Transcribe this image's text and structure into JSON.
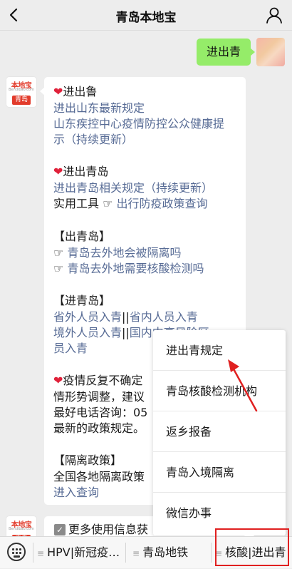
{
  "navbar": {
    "title": "青岛本地宝"
  },
  "user_message": "进出青",
  "bot_avatar": {
    "logo": "本地宝",
    "logo_sub": "Bendibao.com",
    "city": "青岛"
  },
  "message": {
    "heart_glyph": "❤",
    "pointer_glyph": "☞",
    "sec1_title": "进出鲁",
    "sec1_link1": "进出山东最新规定",
    "sec1_link2_l1": "山东疾控中心疫情防控公众健康提",
    "sec1_link2_l2": "示（持续更新）",
    "sec2_title": "进出青岛",
    "sec2_link1": "进出青岛相关规定（持续更新）",
    "sec2_tool_label": "实用工具",
    "sec2_tool_link": "出行防疫政策查询",
    "sec3_title": "【出青岛】",
    "sec3_link1": "青岛去外地会被隔离吗",
    "sec3_link2": "青岛去外地需要核酸检测吗",
    "sec4_title": "【进青岛】",
    "sec4_a": "省外人员入青",
    "sec4_sep": "||",
    "sec4_b": "省内人员入青",
    "sec4_c": "境外人员入青",
    "sec4_d": "国内中高风险区",
    "sec4_e": "员入青",
    "sec5_l1": "疫情反复不确定",
    "sec5_l2": "情形势调整，建议",
    "sec5_l3": "最好电话咨询：05",
    "sec5_l4": "最新的政策规定。",
    "sec6_title": "【隔离政策】",
    "sec6_l1": "全国各地隔离政策",
    "sec6_link": "进入查询"
  },
  "message2": {
    "check_glyph": "✓",
    "text": "更多使用信息获"
  },
  "popup_menu": {
    "items": [
      "进出青规定",
      "青岛核酸检测机构",
      "返乡报备",
      "青岛入境隔离",
      "微信办事"
    ]
  },
  "bottom_menu": {
    "hamburger_glyph": "≡",
    "items": [
      "HPV|新冠疫…",
      "青岛地铁",
      "核酸|进出青"
    ]
  },
  "colors": {
    "link": "#576b95",
    "user_bubble": "#95ec69",
    "annotation": "#e02020",
    "heart": "#e0213a"
  },
  "icons": {
    "back": "chevron-left-icon",
    "profile": "person-icon",
    "keyboard": "keyboard-icon"
  }
}
